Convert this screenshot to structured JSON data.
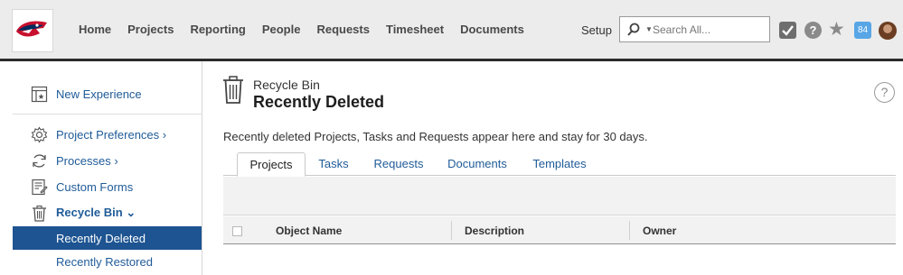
{
  "topbar": {
    "nav": [
      "Home",
      "Projects",
      "Reporting",
      "People",
      "Requests",
      "Timesheet",
      "Documents"
    ],
    "setup_label": "Setup",
    "search_placeholder": "Search All...",
    "notifications_count": "84"
  },
  "sidebar": {
    "items": [
      {
        "label": "New Experience",
        "icon": "new-experience-icon"
      },
      {
        "label": "Project Preferences",
        "icon": "gear-icon",
        "chevron": "›"
      },
      {
        "label": "Processes",
        "icon": "cycle-icon",
        "chevron": "›"
      },
      {
        "label": "Custom Forms",
        "icon": "form-icon"
      },
      {
        "label": "Recycle Bin",
        "icon": "trash-icon",
        "chevron": "⌄"
      }
    ],
    "subitems": [
      {
        "label": "Recently Deleted",
        "active": true
      },
      {
        "label": "Recently Restored",
        "active": false
      }
    ]
  },
  "page": {
    "super_title": "Recycle Bin",
    "title": "Recently Deleted",
    "description": "Recently deleted Projects, Tasks and Requests appear here and stay for 30 days.",
    "help": "?"
  },
  "tabs": [
    {
      "label": "Projects",
      "active": true
    },
    {
      "label": "Tasks",
      "active": false
    },
    {
      "label": "Requests",
      "active": false
    },
    {
      "label": "Documents",
      "active": false
    },
    {
      "label": "Templates",
      "active": false
    }
  ],
  "table": {
    "columns": [
      "Object Name",
      "Description",
      "Owner"
    ]
  },
  "colors": {
    "accent": "#1d5491",
    "link": "#1f5b98",
    "topbar_bg": "#ececec",
    "badge": "#58a6e6"
  }
}
